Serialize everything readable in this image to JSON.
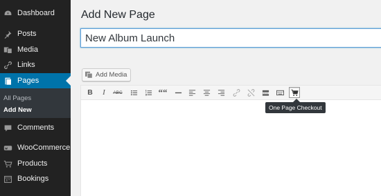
{
  "sidebar": {
    "items": [
      {
        "label": "Dashboard",
        "icon": "dashboard-icon"
      },
      {
        "label": "Posts",
        "icon": "pin-icon"
      },
      {
        "label": "Media",
        "icon": "media-icon"
      },
      {
        "label": "Links",
        "icon": "link-icon"
      },
      {
        "label": "Pages",
        "icon": "page-icon",
        "active": true
      },
      {
        "label": "Comments",
        "icon": "comment-icon"
      },
      {
        "label": "WooCommerce",
        "icon": "woocommerce-icon"
      },
      {
        "label": "Products",
        "icon": "cart-icon"
      },
      {
        "label": "Bookings",
        "icon": "calendar-icon"
      }
    ],
    "submenu": [
      {
        "label": "All Pages"
      },
      {
        "label": "Add New",
        "current": true
      }
    ]
  },
  "main": {
    "page_title": "Add New Page",
    "title_value": "New Album Launch",
    "add_media_label": "Add Media"
  },
  "toolbar": {
    "buttons": [
      "bold",
      "italic",
      "strikethrough",
      "bullet-list",
      "numbered-list",
      "blockquote",
      "horizontal-line",
      "align-left",
      "align-center",
      "align-right",
      "insert-link",
      "remove-link",
      "read-more",
      "toolbar-toggle",
      "one-page-checkout"
    ],
    "bold_label": "B",
    "italic_label": "I",
    "strike_label": "ABC",
    "quote_label": "““",
    "tooltip": "One Page Checkout"
  },
  "colors": {
    "sidebar_bg": "#222222",
    "active_bg": "#0073aa",
    "submenu_bg": "#32373c"
  }
}
